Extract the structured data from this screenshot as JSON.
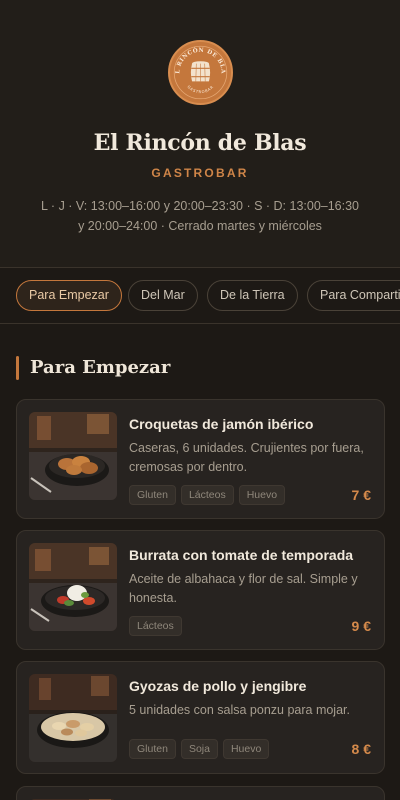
{
  "restaurant": {
    "name": "El Rincón de Blas",
    "tagline": "GASTROBAR",
    "logo_text": "EL RINCÓN DE BLAS",
    "logo_subtext": "GASTROBAR",
    "hours_line1": "L · J · V: 13:00–16:00 y 20:00–23:30 · S · D: 13:00–16:30",
    "hours_line2": "y 20:00–24:00 · Cerrado martes y miércoles"
  },
  "tabs": [
    {
      "label": "Para Empezar",
      "active": true
    },
    {
      "label": "Del Mar",
      "active": false
    },
    {
      "label": "De la Tierra",
      "active": false
    },
    {
      "label": "Para Compartir",
      "active": false
    }
  ],
  "section": {
    "title": "Para Empezar"
  },
  "dishes": [
    {
      "name": "Croquetas de jamón ibérico",
      "description": "Caseras, 6 unidades. Crujientes por fuera, cremosas por dentro.",
      "tags": [
        "Gluten",
        "Lácteos",
        "Huevo"
      ],
      "price": "7 €"
    },
    {
      "name": "Burrata con tomate de temporada",
      "description": "Aceite de albahaca y flor de sal. Simple y honesta.",
      "tags": [
        "Lácteos"
      ],
      "price": "9 €"
    },
    {
      "name": "Gyozas de pollo y jengibre",
      "description": "5 unidades con salsa ponzu para mojar.",
      "tags": [
        "Gluten",
        "Soja",
        "Huevo"
      ],
      "price": "8 €"
    }
  ],
  "colors": {
    "accent": "#c4773c",
    "background": "#1d1915",
    "card": "#272320"
  }
}
